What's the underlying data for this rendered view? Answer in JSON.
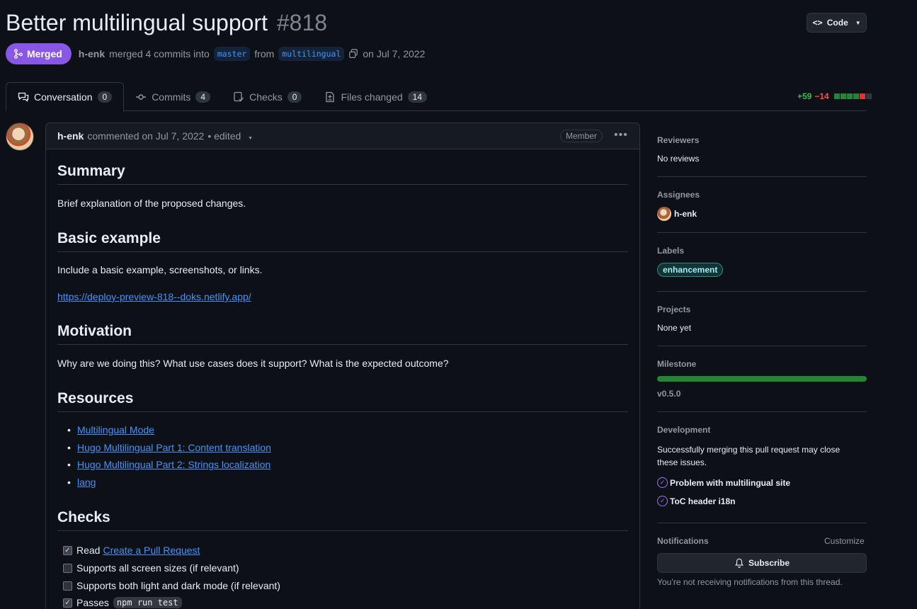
{
  "pr": {
    "title": "Better multilingual support",
    "number": "#818",
    "state_label": "Merged",
    "author": "h-enk",
    "merged_text": "merged 4 commits into",
    "base_branch": "master",
    "from_text": "from",
    "head_branch": "multilingual",
    "date_text": "on Jul 7, 2022"
  },
  "header": {
    "code_button": "Code"
  },
  "tabs": [
    {
      "label": "Conversation",
      "count": "0",
      "icon": "conversation-icon"
    },
    {
      "label": "Commits",
      "count": "4",
      "icon": "commit-icon"
    },
    {
      "label": "Checks",
      "count": "0",
      "icon": "checklist-icon"
    },
    {
      "label": "Files changed",
      "count": "14",
      "icon": "file-diff-icon"
    }
  ],
  "diffstat": {
    "additions": "+59",
    "deletions": "−14",
    "boxes": [
      "add",
      "add",
      "add",
      "add",
      "del",
      "neutral"
    ],
    "colors": {
      "add": "#238636",
      "del": "#da3633",
      "neutral": "#30363d"
    }
  },
  "comment": {
    "author": "h-enk",
    "meta": "commented on Jul 7, 2022",
    "edited": "• edited",
    "badge": "Member",
    "body": {
      "summary_heading": "Summary",
      "summary_text": "Brief explanation of the proposed changes.",
      "example_heading": "Basic example",
      "example_text": "Include a basic example, screenshots, or links.",
      "example_link": "https://deploy-preview-818--doks.netlify.app/",
      "motivation_heading": "Motivation",
      "motivation_text": "Why are we doing this? What use cases does it support? What is the expected outcome?",
      "resources_heading": "Resources",
      "resources": [
        "Multilingual Mode",
        "Hugo Multilingual Part 1: Content translation",
        "Hugo Multilingual Part 2: Strings localization",
        "lang"
      ],
      "checks_heading": "Checks",
      "checks": [
        {
          "checked": true,
          "text": "Read",
          "link": "Create a Pull Request"
        },
        {
          "checked": false,
          "text": "Supports all screen sizes (if relevant)"
        },
        {
          "checked": false,
          "text": "Supports both light and dark mode (if relevant)"
        },
        {
          "checked": true,
          "text": "Passes",
          "code": "npm run test"
        }
      ]
    }
  },
  "sidebar": {
    "reviewers": {
      "heading": "Reviewers",
      "value": "No reviews"
    },
    "assignees": {
      "heading": "Assignees",
      "value": "h-enk"
    },
    "labels": {
      "heading": "Labels",
      "value": "enhancement"
    },
    "projects": {
      "heading": "Projects",
      "value": "None yet"
    },
    "milestone": {
      "heading": "Milestone",
      "value": "v0.5.0",
      "progress": 1.0
    },
    "development": {
      "heading": "Development",
      "text": "Successfully merging this pull request may close these issues.",
      "issues": [
        "Problem with multilingual site",
        "ToC header i18n"
      ]
    },
    "notifications": {
      "heading": "Notifications",
      "customize": "Customize",
      "subscribe": "Subscribe",
      "status": "You’re not receiving notifications from this thread."
    }
  }
}
